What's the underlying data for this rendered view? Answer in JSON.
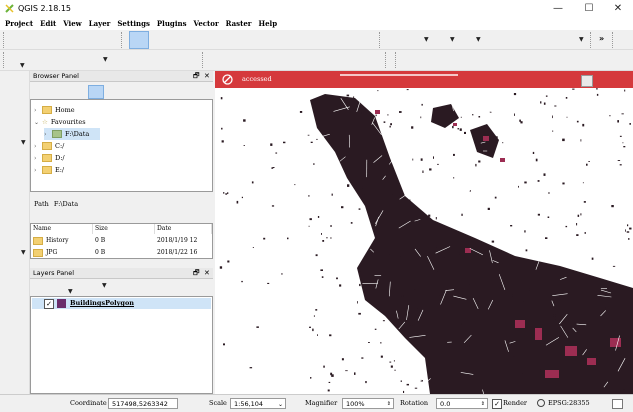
{
  "window": {
    "title": "QGIS 2.18.15",
    "minimize_glyph": "—",
    "maximize_glyph": "☐",
    "close_glyph": "✕"
  },
  "menu": {
    "items": [
      "Project",
      "Edit",
      "View",
      "Layer",
      "Settings",
      "Plugins",
      "Vector",
      "Raster",
      "Help"
    ]
  },
  "toolbar": {
    "overflow_glyph": "»"
  },
  "browser_panel": {
    "title": "Browser Panel",
    "float_glyph": "🗗",
    "close_glyph": "✕",
    "tree": [
      {
        "label": "Home",
        "expanded": false,
        "level": 0,
        "icon": "folder-icon"
      },
      {
        "label": "Favourites",
        "expanded": true,
        "level": 0,
        "icon": "star-icon"
      },
      {
        "label": "F:\\Data",
        "expanded": false,
        "level": 1,
        "icon": "folder-icon"
      },
      {
        "label": "C:/",
        "expanded": false,
        "level": 0,
        "icon": "folder-icon"
      },
      {
        "label": "D:/",
        "expanded": false,
        "level": 0,
        "icon": "folder-icon"
      },
      {
        "label": "E:/",
        "expanded": false,
        "level": 0,
        "icon": "folder-icon"
      }
    ],
    "path_label": "Path",
    "path_value": "F:\\Data",
    "table": {
      "columns": [
        "Name",
        "Size",
        "Date"
      ],
      "rows": [
        [
          "History",
          "0 B",
          "2018/1/19 12"
        ],
        [
          "JPG",
          "0 B",
          "2018/1/22 16"
        ]
      ]
    }
  },
  "layers_panel": {
    "title": "Layers Panel",
    "float_glyph": "🗗",
    "close_glyph": "✕",
    "layers": [
      {
        "name": "BuildingsPolygon",
        "checked": true,
        "color": "#6b2d6b"
      }
    ]
  },
  "message_bar": {
    "text": "accessed",
    "color": "#d5393c"
  },
  "map": {
    "building_color": "#2a1a22",
    "highlight_color": "#9c2d52"
  },
  "status": {
    "coordinate_label": "Coordinate",
    "coordinate_value": "517498,5263342",
    "scale_label": "Scale",
    "scale_value": "1:56,104",
    "magnifier_label": "Magnifier",
    "magnifier_value": "100%",
    "rotation_label": "Rotation",
    "rotation_value": "0.0",
    "render_label": "Render",
    "render_checked": true,
    "crs_label": "EPSG:28355"
  }
}
